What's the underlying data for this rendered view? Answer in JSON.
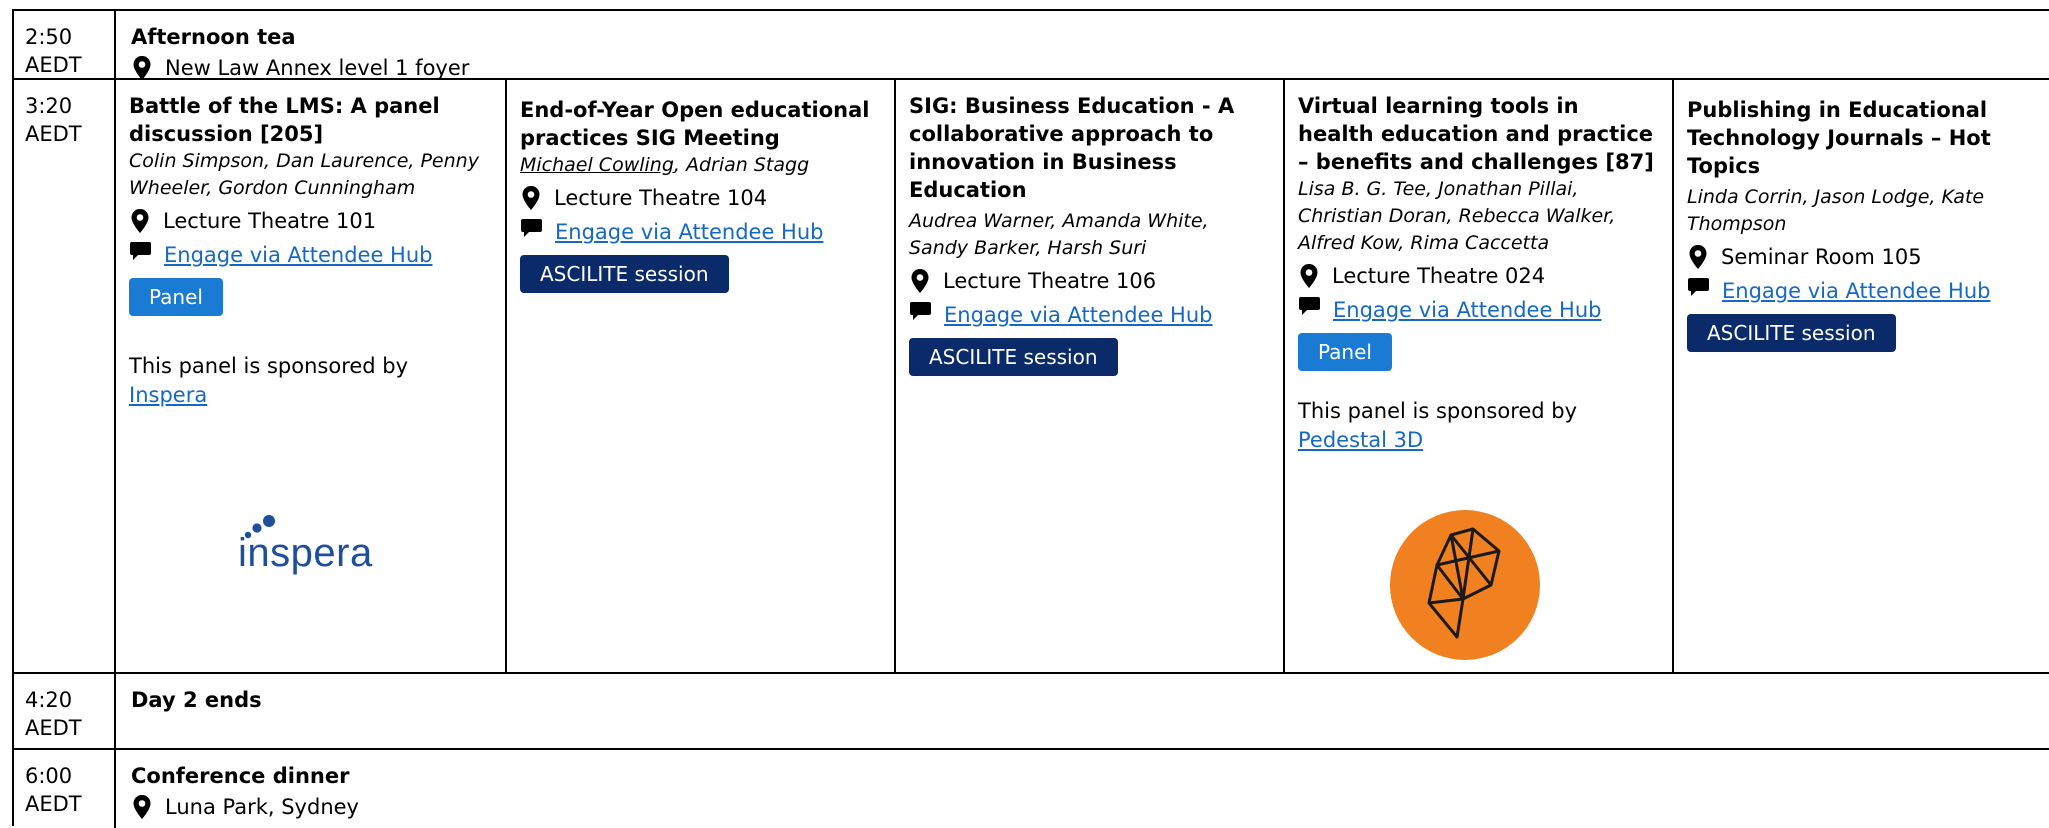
{
  "rows": [
    {
      "time": "2:50",
      "zone": "AEDT",
      "title": "Afternoon tea",
      "location": "New Law Annex level 1 foyer"
    },
    {
      "time": "3:20",
      "zone": "AEDT",
      "sessions": [
        {
          "title": "Battle of the LMS: A panel discussion [205]",
          "authors": "Colin Simpson, Dan Laurence, Penny Wheeler, Gordon Cunningham",
          "location": "Lecture Theatre 101",
          "hub_label": "Engage via Attendee Hub",
          "badge": "Panel",
          "sponsor_text": "This panel is sponsored by",
          "sponsor_link": "Inspera",
          "sponsor_logo_text": "inspera"
        },
        {
          "title": "End-of-Year Open educational practices SIG Meeting",
          "authors_underlined": "Michael Cowling",
          "authors_rest": ", Adrian Stagg",
          "location": "Lecture Theatre 104",
          "hub_label": "Engage via Attendee Hub",
          "badge": "ASCILITE session"
        },
        {
          "title": "SIG: Business Education - A collaborative approach to innovation in Business Education",
          "authors": "Audrea Warner, Amanda White, Sandy Barker, Harsh Suri",
          "location": "Lecture Theatre 106",
          "hub_label": "Engage via Attendee Hub",
          "badge": "ASCILITE session"
        },
        {
          "title": "Virtual learning tools in health education and practice – benefits and challenges [87]",
          "authors": "Lisa B. G. Tee, Jonathan Pillai, Christian Doran, Rebecca Walker, Alfred Kow, Rima Caccetta",
          "location": "Lecture Theatre 024",
          "hub_label": "Engage via Attendee Hub",
          "badge": "Panel",
          "sponsor_text": "This panel is sponsored by",
          "sponsor_link": "Pedestal 3D"
        },
        {
          "title": "Publishing in Educational Technology Journals – Hot Topics",
          "authors": "Linda Corrin, Jason Lodge, Kate Thompson",
          "location": "Seminar Room 105",
          "hub_label": "Engage via Attendee Hub",
          "badge": "ASCILITE session"
        }
      ]
    },
    {
      "time": "4:20",
      "zone": "AEDT",
      "title": "Day 2 ends"
    },
    {
      "time": "6:00",
      "zone": "AEDT",
      "title": "Conference dinner",
      "location": "Luna Park, Sydney"
    }
  ],
  "icons": {
    "location": "map-pin-icon",
    "engage": "chat-bubble-icon"
  },
  "colors": {
    "link": "#1668c6",
    "panel_badge": "#1a7bd4",
    "ascilite_badge": "#0a2a6a",
    "inspera_logo": "#1f4e9c",
    "pedestal_logo": "#f08020"
  }
}
